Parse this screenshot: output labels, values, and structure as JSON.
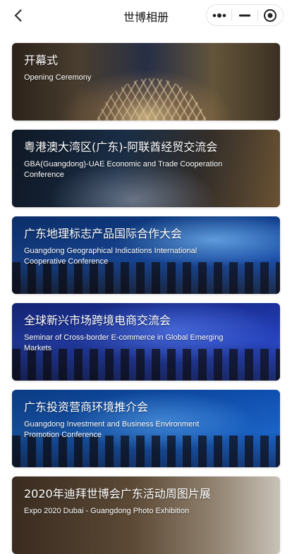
{
  "navbar": {
    "title": "世博相册",
    "back_icon": "chevron-left-icon",
    "capsule": [
      "more-dots-icon",
      "minimize-icon",
      "close-target-icon"
    ]
  },
  "albums": [
    {
      "title": "开幕式",
      "subtitle": "Opening Ceremony"
    },
    {
      "title": "粤港澳大湾区(广东)-阿联酋经贸交流会",
      "subtitle": "GBA(Guangdong)-UAE Economic and Trade Cooperation Conference"
    },
    {
      "title": "广东地理标志产品国际合作大会",
      "subtitle": "Guangdong Geographical Indications International Cooperative Conference"
    },
    {
      "title": "全球新兴市场跨境电商交流会",
      "subtitle": "Seminar of Cross-border E-commerce in Global Emerging Markets"
    },
    {
      "title": "广东投资营商环境推介会",
      "subtitle": "Guangdong Investment and Business Environment Promotion Conference"
    },
    {
      "title": "2020年迪拜世博会广东活动周图片展",
      "subtitle": "Expo 2020 Dubai - Guangdong Photo Exhibition"
    }
  ]
}
